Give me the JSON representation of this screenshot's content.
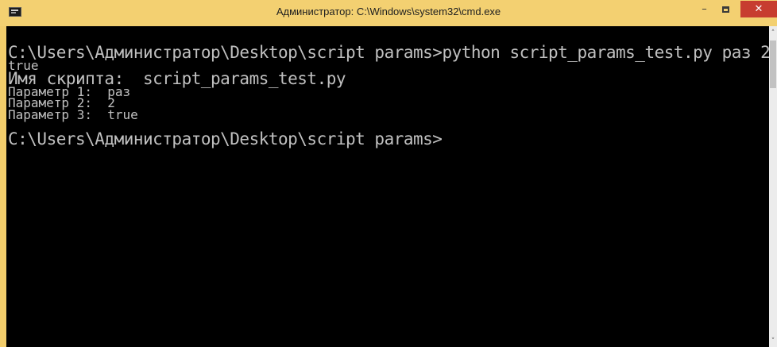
{
  "window": {
    "title": "Администратор: C:\\Windows\\system32\\cmd.exe",
    "minimize_label": "–",
    "close_label": "✕",
    "icon": "cmd-icon"
  },
  "console": {
    "lines": [
      "C:\\Users\\Администратор\\Desktop\\script params>python script_params_test.py раз 2",
      "true",
      "Имя скрипта:  script_params_test.py",
      "Параметр 1:  раз",
      "Параметр 2:  2",
      "Параметр 3:  true",
      "C:\\Users\\Администратор\\Desktop\\script params>"
    ]
  },
  "scrollbar": {
    "up_arrow": "˄",
    "down_arrow": "˅"
  },
  "colors": {
    "titlebar": "#f3d071",
    "close_button": "#c73d30",
    "console_bg": "#000000",
    "console_text": "#c0c0c0"
  }
}
